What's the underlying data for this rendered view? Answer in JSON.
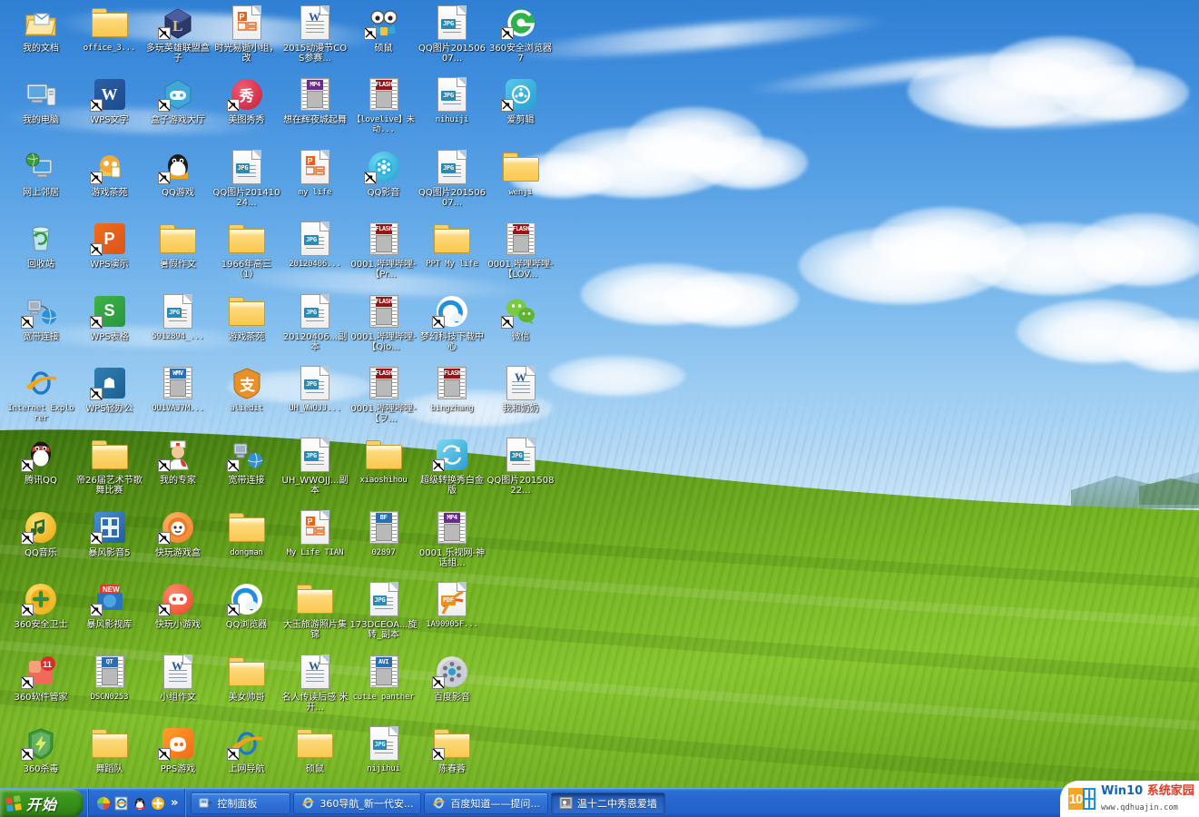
{
  "desktop": {
    "wallpaper_name": "bliss-wallpaper",
    "sky_color": "#3e8cdc",
    "grass_color": "#6aa31d"
  },
  "icons": [
    {
      "label": "我的文档",
      "art": "my-documents-icon",
      "cjk": true,
      "shortcut": false,
      "col": 0,
      "row": 0
    },
    {
      "label": "office_3...",
      "art": "folder-icon",
      "cjk": false,
      "shortcut": false,
      "col": 1,
      "row": 0
    },
    {
      "label": "多玩英雄联盟盒子",
      "art": "lol-box-icon",
      "cjk": true,
      "shortcut": true,
      "col": 2,
      "row": 0
    },
    {
      "label": "时光易逝小组，改",
      "art": "powerpoint-doc-icon",
      "cjk": true,
      "shortcut": false,
      "col": 3,
      "row": 0
    },
    {
      "label": "2015动漫节COS参赛...",
      "art": "word-doc-icon",
      "cjk": true,
      "shortcut": false,
      "col": 4,
      "row": 0
    },
    {
      "label": "硕鼠",
      "art": "shuoshu-icon",
      "cjk": true,
      "shortcut": true,
      "col": 5,
      "row": 0
    },
    {
      "label": "QQ图片20150607...",
      "art": "jpg-doc-icon",
      "cjk": true,
      "shortcut": false,
      "col": 6,
      "row": 0
    },
    {
      "label": "360安全浏览器7",
      "art": "360-browser-icon",
      "cjk": true,
      "shortcut": true,
      "col": 7,
      "row": 0
    },
    {
      "label": "我的电脑",
      "art": "my-computer-icon",
      "cjk": true,
      "shortcut": false,
      "col": 0,
      "row": 1
    },
    {
      "label": "WPS文字",
      "art": "wps-writer-icon",
      "cjk": true,
      "shortcut": true,
      "col": 1,
      "row": 1
    },
    {
      "label": "盒子游戏大厅",
      "art": "game-hall-icon",
      "cjk": true,
      "shortcut": true,
      "col": 2,
      "row": 1
    },
    {
      "label": "美图秀秀",
      "art": "meitu-icon",
      "cjk": true,
      "shortcut": true,
      "col": 3,
      "row": 1
    },
    {
      "label": "想在辉夜城起舞",
      "art": "mp4-film-icon",
      "cjk": true,
      "shortcut": false,
      "col": 4,
      "row": 1
    },
    {
      "label": "【lovelive】未动...",
      "art": "flash-film-icon",
      "cjk": false,
      "shortcut": false,
      "col": 5,
      "row": 1
    },
    {
      "label": "nihuiji",
      "art": "jpg-doc-icon",
      "cjk": false,
      "shortcut": false,
      "col": 6,
      "row": 1
    },
    {
      "label": "爱剪辑",
      "art": "aijianji-icon",
      "cjk": true,
      "shortcut": true,
      "col": 7,
      "row": 1
    },
    {
      "label": "网上邻居",
      "art": "network-places-icon",
      "cjk": true,
      "shortcut": false,
      "col": 0,
      "row": 2
    },
    {
      "label": "游戏茶苑",
      "art": "chayuan-icon",
      "cjk": true,
      "shortcut": true,
      "col": 1,
      "row": 2
    },
    {
      "label": "QQ游戏",
      "art": "qq-game-icon",
      "cjk": true,
      "shortcut": true,
      "col": 2,
      "row": 2
    },
    {
      "label": "QQ图片20141024...",
      "art": "jpg-doc-icon",
      "cjk": true,
      "shortcut": false,
      "col": 3,
      "row": 2
    },
    {
      "label": "my life",
      "art": "powerpoint-doc-icon",
      "cjk": false,
      "shortcut": false,
      "col": 4,
      "row": 2
    },
    {
      "label": "QQ影音",
      "art": "qq-player-icon",
      "cjk": true,
      "shortcut": true,
      "col": 5,
      "row": 2
    },
    {
      "label": "QQ图片20150607...",
      "art": "jpg-doc-icon",
      "cjk": true,
      "shortcut": false,
      "col": 6,
      "row": 2
    },
    {
      "label": "wenji",
      "art": "folder-icon",
      "cjk": false,
      "shortcut": false,
      "col": 7,
      "row": 2
    },
    {
      "label": "回收站",
      "art": "recycle-bin-icon",
      "cjk": true,
      "shortcut": false,
      "col": 0,
      "row": 3
    },
    {
      "label": "WPS演示",
      "art": "wps-present-icon",
      "cjk": true,
      "shortcut": true,
      "col": 1,
      "row": 3
    },
    {
      "label": "暑假作文",
      "art": "folder-icon",
      "cjk": true,
      "shortcut": false,
      "col": 2,
      "row": 3
    },
    {
      "label": "1966年高三（1）",
      "art": "folder-icon",
      "cjk": true,
      "shortcut": false,
      "col": 3,
      "row": 3
    },
    {
      "label": "20120406...",
      "art": "jpg-doc-icon",
      "cjk": false,
      "shortcut": false,
      "col": 4,
      "row": 3
    },
    {
      "label": "0001.哔哩哔哩-【Pr...",
      "art": "flash-film-icon",
      "cjk": true,
      "shortcut": false,
      "col": 5,
      "row": 3
    },
    {
      "label": "PPT My life",
      "art": "folder-icon",
      "cjk": false,
      "shortcut": false,
      "col": 6,
      "row": 3
    },
    {
      "label": "0001.哔哩哔哩-【LOV...",
      "art": "flash-film-icon",
      "cjk": true,
      "shortcut": false,
      "col": 7,
      "row": 3
    },
    {
      "label": "宽带连接",
      "art": "broadband-icon",
      "cjk": true,
      "shortcut": true,
      "col": 0,
      "row": 4
    },
    {
      "label": "WPS表格",
      "art": "wps-sheet-icon",
      "cjk": true,
      "shortcut": true,
      "col": 1,
      "row": 4
    },
    {
      "label": "5912894_...",
      "art": "jpg-doc-icon",
      "cjk": false,
      "shortcut": false,
      "col": 2,
      "row": 4
    },
    {
      "label": "游戏茶苑",
      "art": "folder-icon",
      "cjk": true,
      "shortcut": false,
      "col": 3,
      "row": 4
    },
    {
      "label": "20120406...副本",
      "art": "jpg-doc-icon",
      "cjk": true,
      "shortcut": false,
      "col": 4,
      "row": 4
    },
    {
      "label": "0001.哔哩哔哩-【Qio...",
      "art": "flash-film-icon",
      "cjk": true,
      "shortcut": false,
      "col": 5,
      "row": 4
    },
    {
      "label": "梦幻科技下载中心",
      "art": "qq-browser-icon",
      "cjk": true,
      "shortcut": true,
      "col": 6,
      "row": 4
    },
    {
      "label": "微信",
      "art": "wechat-icon",
      "cjk": true,
      "shortcut": true,
      "col": 7,
      "row": 4
    },
    {
      "label": "Internet Explorer",
      "art": "ie-icon",
      "cjk": false,
      "shortcut": false,
      "col": 0,
      "row": 5
    },
    {
      "label": "WPS轻办公",
      "art": "wps-office-icon",
      "cjk": true,
      "shortcut": true,
      "col": 1,
      "row": 5
    },
    {
      "label": "OU1VAJ7M...",
      "art": "wmv-film-icon",
      "cjk": false,
      "shortcut": false,
      "col": 2,
      "row": 5
    },
    {
      "label": "aliedit",
      "art": "alipay-icon",
      "cjk": false,
      "shortcut": false,
      "col": 3,
      "row": 5
    },
    {
      "label": "UH_WWOJJ...",
      "art": "jpg-doc-icon",
      "cjk": false,
      "shortcut": false,
      "col": 4,
      "row": 5
    },
    {
      "label": "0001.哔哩哔哩-【ヲ...",
      "art": "flash-film-icon",
      "cjk": true,
      "shortcut": false,
      "col": 5,
      "row": 5
    },
    {
      "label": "bingzhang",
      "art": "flash-film-icon",
      "cjk": false,
      "shortcut": false,
      "col": 6,
      "row": 5
    },
    {
      "label": "我和奶奶",
      "art": "word-doc-icon",
      "cjk": true,
      "shortcut": false,
      "col": 7,
      "row": 5
    },
    {
      "label": "腾讯QQ",
      "art": "qq-icon",
      "cjk": true,
      "shortcut": true,
      "col": 0,
      "row": 6
    },
    {
      "label": "帝26届艺术节歌舞比赛",
      "art": "folder-icon",
      "cjk": true,
      "shortcut": false,
      "col": 1,
      "row": 6
    },
    {
      "label": "我的专家",
      "art": "expert-icon",
      "cjk": true,
      "shortcut": true,
      "col": 2,
      "row": 6
    },
    {
      "label": "宽带连接",
      "art": "broadband-icon",
      "cjk": true,
      "shortcut": true,
      "col": 3,
      "row": 6
    },
    {
      "label": "UH_WWOJJ...副本",
      "art": "jpg-doc-icon",
      "cjk": true,
      "shortcut": false,
      "col": 4,
      "row": 6
    },
    {
      "label": "xiaoshihou",
      "art": "folder-icon",
      "cjk": false,
      "shortcut": false,
      "col": 5,
      "row": 6
    },
    {
      "label": "超级转换秀白金版",
      "art": "convert-icon",
      "cjk": true,
      "shortcut": true,
      "col": 6,
      "row": 6
    },
    {
      "label": "QQ图片20150822...",
      "art": "jpg-doc-icon",
      "cjk": true,
      "shortcut": false,
      "col": 7,
      "row": 6
    },
    {
      "label": "QQ音乐",
      "art": "qq-music-icon",
      "cjk": true,
      "shortcut": true,
      "col": 0,
      "row": 7
    },
    {
      "label": "暴风影音5",
      "art": "baofeng-icon",
      "cjk": true,
      "shortcut": true,
      "col": 1,
      "row": 7
    },
    {
      "label": "快玩游戏盒",
      "art": "kuaiwan-icon",
      "cjk": true,
      "shortcut": true,
      "col": 2,
      "row": 7
    },
    {
      "label": "dongman",
      "art": "folder-icon",
      "cjk": false,
      "shortcut": false,
      "col": 3,
      "row": 7
    },
    {
      "label": "My Life TIAN",
      "art": "powerpoint-doc-icon",
      "cjk": false,
      "shortcut": false,
      "col": 4,
      "row": 7
    },
    {
      "label": "02897",
      "art": "bf-film-icon",
      "cjk": false,
      "shortcut": false,
      "col": 5,
      "row": 7
    },
    {
      "label": "0001.乐视网-神话组...",
      "art": "mp4-film-icon",
      "cjk": true,
      "shortcut": false,
      "col": 6,
      "row": 7
    },
    {
      "label": "360安全卫士",
      "art": "360-safe-icon",
      "cjk": true,
      "shortcut": true,
      "col": 0,
      "row": 8
    },
    {
      "label": "暴风影视库",
      "art": "baofeng-lib-icon",
      "cjk": true,
      "shortcut": true,
      "col": 1,
      "row": 8
    },
    {
      "label": "快玩小游戏",
      "art": "kuaiwan-mini-icon",
      "cjk": true,
      "shortcut": true,
      "col": 2,
      "row": 8
    },
    {
      "label": "QQ浏览器",
      "art": "qq-browser-icon",
      "cjk": true,
      "shortcut": true,
      "col": 3,
      "row": 8
    },
    {
      "label": "大玉旅游照片集锦",
      "art": "folder-icon",
      "cjk": true,
      "shortcut": false,
      "col": 4,
      "row": 8
    },
    {
      "label": "173DCEOA...旋转_副本",
      "art": "jpg-doc-icon",
      "cjk": true,
      "shortcut": false,
      "col": 5,
      "row": 8
    },
    {
      "label": "1A90905F...",
      "art": "pdf-doc-icon",
      "cjk": false,
      "shortcut": false,
      "col": 6,
      "row": 8
    },
    {
      "label": "360软件管家",
      "art": "360-soft-icon",
      "cjk": true,
      "shortcut": true,
      "col": 0,
      "row": 9
    },
    {
      "label": "DSCN0253",
      "art": "qt-film-icon",
      "cjk": false,
      "shortcut": false,
      "col": 1,
      "row": 9
    },
    {
      "label": "小组作文",
      "art": "word-doc-icon",
      "cjk": true,
      "shortcut": false,
      "col": 2,
      "row": 9
    },
    {
      "label": "美女帅哥",
      "art": "folder-icon",
      "cjk": true,
      "shortcut": false,
      "col": 3,
      "row": 9
    },
    {
      "label": "名人传读后感 米开...",
      "art": "word-doc-icon",
      "cjk": true,
      "shortcut": false,
      "col": 4,
      "row": 9
    },
    {
      "label": "cutie panther",
      "art": "avi-film-icon",
      "cjk": false,
      "shortcut": false,
      "col": 5,
      "row": 9
    },
    {
      "label": "百度影音",
      "art": "baidu-player-icon",
      "cjk": true,
      "shortcut": true,
      "col": 6,
      "row": 9
    },
    {
      "label": "360杀毒",
      "art": "360-antivirus-icon",
      "cjk": true,
      "shortcut": true,
      "col": 0,
      "row": 10
    },
    {
      "label": "舞蹈队",
      "art": "folder-icon",
      "cjk": true,
      "shortcut": false,
      "col": 1,
      "row": 10
    },
    {
      "label": "PPS游戏",
      "art": "pps-game-icon",
      "cjk": true,
      "shortcut": true,
      "col": 2,
      "row": 10
    },
    {
      "label": "上网导航",
      "art": "ie-icon",
      "cjk": true,
      "shortcut": true,
      "col": 3,
      "row": 10
    },
    {
      "label": "硕鼠",
      "art": "folder-icon",
      "cjk": true,
      "shortcut": false,
      "col": 4,
      "row": 10
    },
    {
      "label": "nijihui",
      "art": "jpg-doc-icon",
      "cjk": false,
      "shortcut": false,
      "col": 5,
      "row": 10
    },
    {
      "label": "陈春蓉",
      "art": "folder-icon",
      "cjk": true,
      "shortcut": true,
      "col": 6,
      "row": 10
    }
  ],
  "taskbar": {
    "start_label": "开始",
    "overflow_chevron": "»",
    "quick_launch": [
      {
        "name": "show-desktop-icon"
      },
      {
        "name": "ie-quick-icon"
      },
      {
        "name": "qq-quick-icon"
      },
      {
        "name": "360-quick-icon"
      }
    ],
    "tasks": [
      {
        "label": "控制面板",
        "icon": "control-panel-icon",
        "active": false
      },
      {
        "label": "360导航_新一代安...",
        "icon": "ie-icon",
        "active": false
      },
      {
        "label": "百度知道——提问...",
        "icon": "ie-icon",
        "active": false
      },
      {
        "label": "温十二中秀恩爱墙",
        "icon": "photo-window-icon",
        "active": true
      }
    ]
  },
  "watermark": {
    "logo_number": "10",
    "title_part1": "Win",
    "title_part2": "10",
    "title_part3": "系统家园",
    "url": "www.qdhuajin.com"
  }
}
